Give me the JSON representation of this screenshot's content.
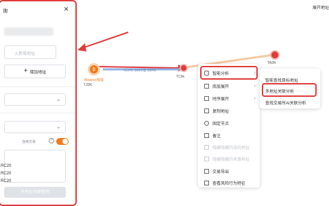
{
  "panel": {
    "title": "询",
    "close": "×",
    "address_placeholder": "入新增地址",
    "add_address_label": "增加地址",
    "toggle_label": "连续交易",
    "list_items": [
      "RC20",
      "RC20",
      "RC20"
    ],
    "submit_label": "多地址关联查询"
  },
  "top_link": "展开地址",
  "graph": {
    "node_left_name": "Binance热钱",
    "node_left_addr": "TJDK",
    "edge_label": "<0.0% 100/1笔 100%",
    "node_mid_addr": "TC9k",
    "node_right_addr": "TA9N"
  },
  "context_menu": {
    "items": [
      {
        "label": "智能分析",
        "has_sub": true
      },
      {
        "label": "底层展开",
        "has_sub": true
      },
      {
        "label": "时序展开",
        "has_sub": true
      },
      {
        "label": "复制地址",
        "has_sub": false
      },
      {
        "label": "固定节点",
        "has_sub": false
      },
      {
        "label": "备注",
        "has_sub": false
      },
      {
        "label": "隐藏隐藏的流向地址",
        "has_sub": false,
        "disabled": true
      },
      {
        "label": "隐藏隐藏的来源地址",
        "has_sub": false,
        "disabled": true
      },
      {
        "label": "交易导出",
        "has_sub": false
      },
      {
        "label": "查看风险行为特征",
        "has_sub": false
      }
    ]
  },
  "sub_menu": {
    "items": [
      "智能查找目标地址",
      "多地址关联分析",
      "查找交易所AI关联分析"
    ]
  },
  "colors": {
    "accent": "#f07b1c",
    "highlight": "#e03a3a",
    "edge": "#8fb0e8"
  }
}
